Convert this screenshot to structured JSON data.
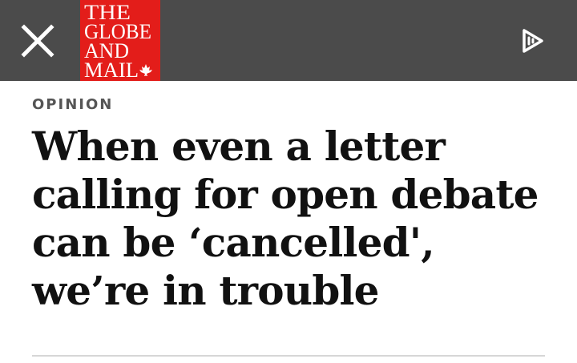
{
  "header": {
    "logo_lines": [
      "THE",
      "GLOBE",
      "AND",
      "MAIL"
    ],
    "logo_color": "#e31d1a",
    "bar_color": "#4b4b4b",
    "close_icon": "close-icon",
    "listen_icon": "play-audio-icon"
  },
  "article": {
    "section": "OPINION",
    "headline": "When even a letter calling for open debate can be ‘cancelled', we’re in trouble"
  }
}
